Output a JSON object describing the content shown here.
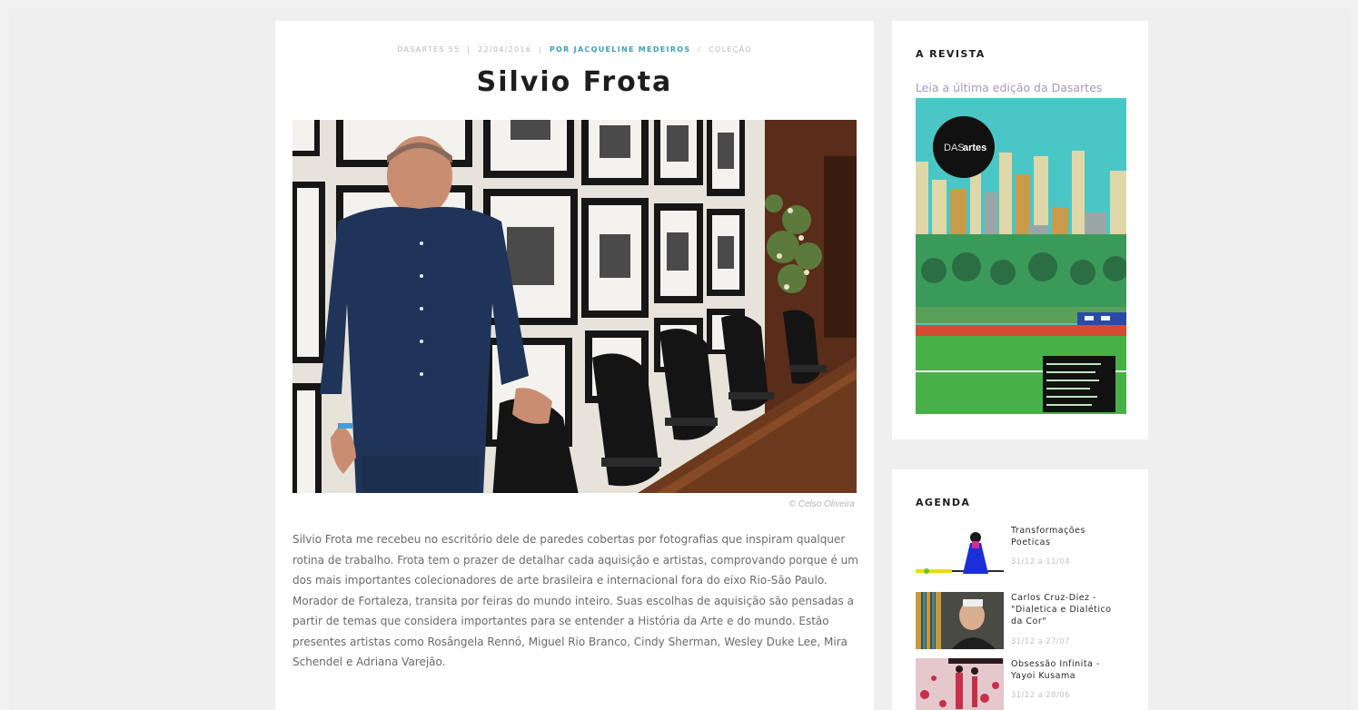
{
  "article": {
    "meta": {
      "issue": "DASARTES 55",
      "separator": "|",
      "date": "22/04/2016",
      "author": "POR JACQUELINE MEDEIROS",
      "separator2": "/",
      "category": "COLEÇÃO"
    },
    "title": "Silvio Frota",
    "photo_credit": "© Celso Oliveira",
    "body": "Silvio Frota me recebeu no escritório dele de paredes cobertas por fotografias que inspiram qualquer rotina de trabalho. Frota tem o prazer de detalhar cada aquisição e artistas, comprovando porque é um dos mais importantes colecionadores de arte brasileira e internacional fora do eixo Rio-São Paulo. Morador de Fortaleza, transita por feiras do mundo inteiro. Suas escolhas de aquisição são pensadas a partir de temas que considera importantes para se entender a História da Arte e do mundo. Estão presentes artistas como Rosângela Rennó, Miguel Rio Branco, Cindy Sherman, Wesley Duke Lee, Mira Schendel e Adriana Varejão."
  },
  "sidebar": {
    "revista": {
      "title": "A REVISTA",
      "link": "Leia a última edição da Dasartes",
      "cover_logo_a": "DAS",
      "cover_logo_b": "artes"
    },
    "agenda": {
      "title": "AGENDA",
      "items": [
        {
          "title": "Transformações Poeticas",
          "date": "31/12 a 11/04"
        },
        {
          "title": "Carlos Cruz-Diez - \"Dialetica e Dialético da Cor\"",
          "date": "31/12 a 27/07"
        },
        {
          "title": "Obsessão Infinita - Yayoi Kusama",
          "date": "31/12 a 28/06"
        }
      ]
    }
  },
  "colors": {
    "page_bg": "#efefef",
    "card_bg": "#ffffff",
    "author_accent": "#3aa0c3",
    "link_accent": "#a798bd",
    "shirt_blue": "#1f3458",
    "cover_teal": "#4bc6c6"
  }
}
